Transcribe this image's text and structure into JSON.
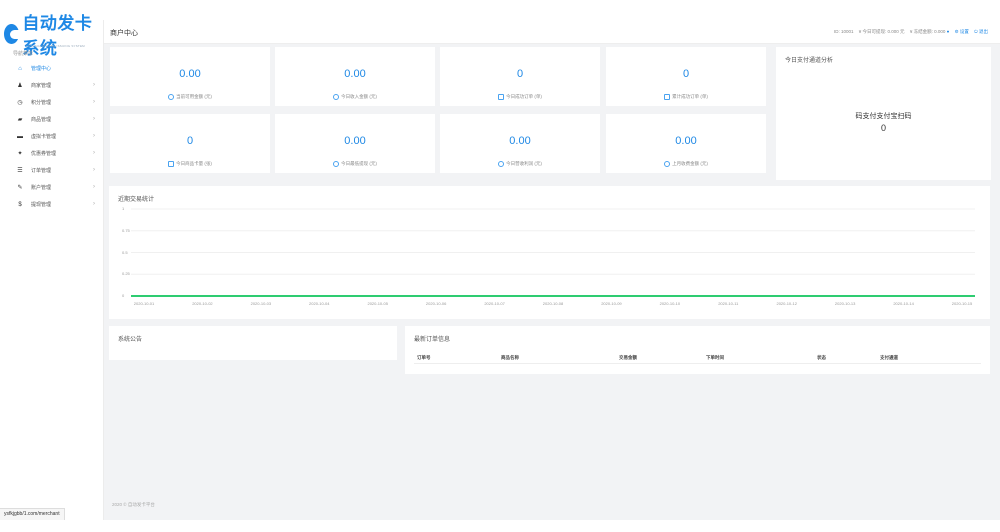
{
  "sidebar": {
    "logo_text": "自动发卡系统",
    "logo_sub": "AUTOMATIC CARD ISSUING SYSTEM",
    "caption": "导航菜单",
    "items": [
      {
        "label": "管理中心",
        "icon": "home-icon",
        "glyph": "⌂"
      },
      {
        "label": "商家管理",
        "icon": "user-icon",
        "glyph": "♟"
      },
      {
        "label": "积分管理",
        "icon": "clock-icon",
        "glyph": "◷"
      },
      {
        "label": "商品管理",
        "icon": "shop-icon",
        "glyph": "▰"
      },
      {
        "label": "虚拟卡管理",
        "icon": "card-icon",
        "glyph": "▬"
      },
      {
        "label": "优惠券管理",
        "icon": "rocket-icon",
        "glyph": "✦"
      },
      {
        "label": "订单管理",
        "icon": "list-icon",
        "glyph": "☰"
      },
      {
        "label": "账户管理",
        "icon": "tools-icon",
        "glyph": "✎"
      },
      {
        "label": "提现管理",
        "icon": "dollar-icon",
        "glyph": "$"
      }
    ],
    "url": "ysfkjgbb/1.com/merchant"
  },
  "header": {
    "title": "商户中心",
    "id_label": "ID: 10001",
    "balance_label": "¥ 今日可提现: 0.000 元",
    "frozen_label": "¥ 冻结金额: 0.000",
    "settings": "设置",
    "logout": "退出"
  },
  "stats": [
    {
      "value": "0.00",
      "label": "当前可用金额 (元)",
      "icon": "coin-icon"
    },
    {
      "value": "0.00",
      "label": "今日收入金额 (元)",
      "icon": "coin-icon"
    },
    {
      "value": "0",
      "label": "今日成功订单 (单)",
      "icon": "order-icon"
    },
    {
      "value": "0",
      "label": "累计成功订单 (单)",
      "icon": "order-icon"
    },
    {
      "value": "0",
      "label": "今日商品卡量 (张)",
      "icon": "card-icon"
    },
    {
      "value": "0.00",
      "label": "今日最低提现 (元)",
      "icon": "coin-icon"
    },
    {
      "value": "0.00",
      "label": "今日营收利润 (元)",
      "icon": "box-icon"
    },
    {
      "value": "0.00",
      "label": "上月收费金额 (元)",
      "icon": "user-icon"
    }
  ],
  "qr_panel": {
    "title": "今日支付通道分析",
    "text": "码支付支付宝扫码",
    "value": "0"
  },
  "chart": {
    "title": "近期交易统计",
    "line_color": "#2ecc71",
    "y_ticks": [
      "1",
      "0.75",
      "0.5",
      "0.25",
      "0"
    ]
  },
  "chart_data": {
    "type": "line",
    "title": "近期交易统计",
    "categories": [
      "2020-10-01",
      "2020-10-02",
      "2020-10-03",
      "2020-10-04",
      "2020-10-05",
      "2020-10-06",
      "2020-10-07",
      "2020-10-08",
      "2020-10-09",
      "2020-10-10",
      "2020-10-11",
      "2020-10-12",
      "2020-10-13",
      "2020-10-14",
      "2020-10-15"
    ],
    "values": [
      0,
      0,
      0,
      0,
      0,
      0,
      0,
      0,
      0,
      0,
      0,
      0,
      0,
      0,
      0
    ],
    "ylim": [
      0,
      1
    ],
    "grid": true
  },
  "announce": {
    "title": "系统公告"
  },
  "orders": {
    "title": "最新订单信息",
    "columns": [
      "订单号",
      "商品名称",
      "交易金额",
      "下单时间",
      "状态",
      "支付通道"
    ]
  },
  "footer": "2020 © 自动发卡平台"
}
